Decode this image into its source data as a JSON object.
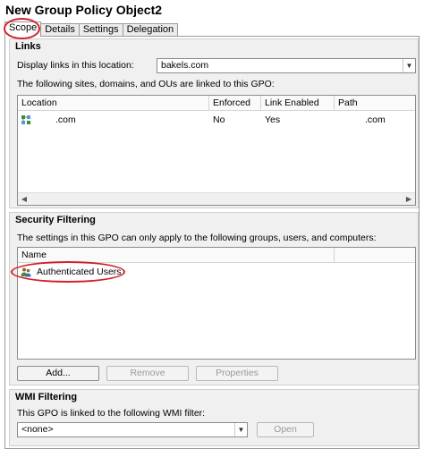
{
  "window": {
    "title": "New Group Policy Object2"
  },
  "tabs": [
    {
      "label": "Scope"
    },
    {
      "label": "Details"
    },
    {
      "label": "Settings"
    },
    {
      "label": "Delegation"
    }
  ],
  "links": {
    "heading": "Links",
    "display_label": "Display links in this location:",
    "location_value": "bakels.com",
    "description": "The following sites, domains, and OUs are linked to this GPO:",
    "columns": [
      "Location",
      "Enforced",
      "Link Enabled",
      "Path"
    ],
    "rows": [
      {
        "location": ".com",
        "enforced": "No",
        "link_enabled": "Yes",
        "path": ".com"
      }
    ]
  },
  "security": {
    "heading": "Security Filtering",
    "description": "The settings in this GPO can only apply to the following groups, users, and computers:",
    "columns": [
      "Name"
    ],
    "rows": [
      {
        "name": "Authenticated Users"
      }
    ],
    "buttons": {
      "add": "Add...",
      "remove": "Remove",
      "properties": "Properties"
    }
  },
  "wmi": {
    "heading": "WMI Filtering",
    "description": "This GPO is linked to the following WMI filter:",
    "filter_value": "<none>",
    "open_button": "Open"
  },
  "colors": {
    "annotation_red": "#d4202a",
    "section_bg": "#f0f0f0"
  }
}
